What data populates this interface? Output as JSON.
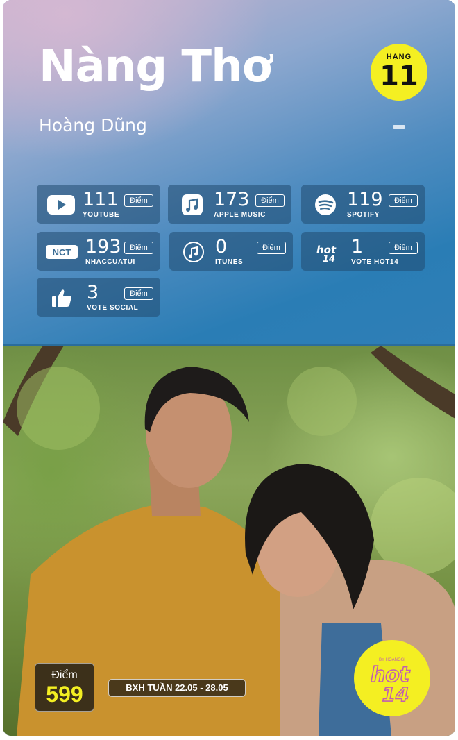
{
  "song": {
    "title": "Nàng Thơ",
    "artist": "Hoàng Dũng",
    "rank_label": "HẠNG",
    "rank": "11",
    "rank_change": "-"
  },
  "point_label": "Điểm",
  "platforms": [
    {
      "value": "111",
      "label": "YOUTUBE",
      "icon": "youtube-icon"
    },
    {
      "value": "173",
      "label": "APPLE MUSIC",
      "icon": "apple-music-icon"
    },
    {
      "value": "119",
      "label": "SPOTIFY",
      "icon": "spotify-icon"
    },
    {
      "value": "193",
      "label": "NHACCUATUI",
      "icon": "nct-icon"
    },
    {
      "value": "0",
      "label": "ITUNES",
      "icon": "itunes-icon"
    },
    {
      "value": "1",
      "label": "VOTE HOT14",
      "icon": "hot14-icon"
    },
    {
      "value": "3",
      "label": "VOTE SOCIAL",
      "icon": "thumbs-up-icon"
    }
  ],
  "footer": {
    "score_label": "Điểm",
    "score": "599",
    "week": "BXH TUẦN 22.05 - 28.05"
  },
  "logo": {
    "text": "HOT14",
    "sub": "BY HOANGGI"
  },
  "colors": {
    "accent": "#f4ef22",
    "panel": "#2a7db5"
  }
}
